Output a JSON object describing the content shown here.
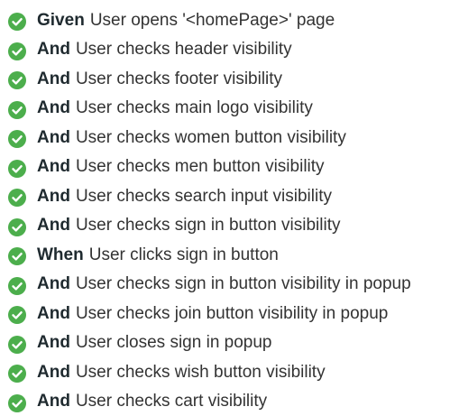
{
  "steps": [
    {
      "keyword": "Given",
      "text": "User opens '<homePage>' page",
      "status": "passed",
      "icon": "check-circle-icon"
    },
    {
      "keyword": "And",
      "text": "User checks header visibility",
      "status": "passed",
      "icon": "check-circle-icon"
    },
    {
      "keyword": "And",
      "text": "User checks footer visibility",
      "status": "passed",
      "icon": "check-circle-icon"
    },
    {
      "keyword": "And",
      "text": "User checks main logo visibility",
      "status": "passed",
      "icon": "check-circle-icon"
    },
    {
      "keyword": "And",
      "text": "User checks women button visibility",
      "status": "passed",
      "icon": "check-circle-icon"
    },
    {
      "keyword": "And",
      "text": "User checks men button visibility",
      "status": "passed",
      "icon": "check-circle-icon"
    },
    {
      "keyword": "And",
      "text": "User checks search input visibility",
      "status": "passed",
      "icon": "check-circle-icon"
    },
    {
      "keyword": "And",
      "text": "User checks sign in button visibility",
      "status": "passed",
      "icon": "check-circle-icon"
    },
    {
      "keyword": "When",
      "text": "User clicks sign in button",
      "status": "passed",
      "icon": "check-circle-icon"
    },
    {
      "keyword": "And",
      "text": "User checks sign in button visibility in popup",
      "status": "passed",
      "icon": "check-circle-icon"
    },
    {
      "keyword": "And",
      "text": "User checks join button visibility in popup",
      "status": "passed",
      "icon": "check-circle-icon"
    },
    {
      "keyword": "And",
      "text": "User closes sign in popup",
      "status": "passed",
      "icon": "check-circle-icon"
    },
    {
      "keyword": "And",
      "text": "User checks wish button visibility",
      "status": "passed",
      "icon": "check-circle-icon"
    },
    {
      "keyword": "And",
      "text": "User checks cart visibility",
      "status": "passed",
      "icon": "check-circle-icon"
    }
  ],
  "colors": {
    "passed": "#4cae4c",
    "keyword": "#1f2a2f",
    "text": "#333333"
  }
}
